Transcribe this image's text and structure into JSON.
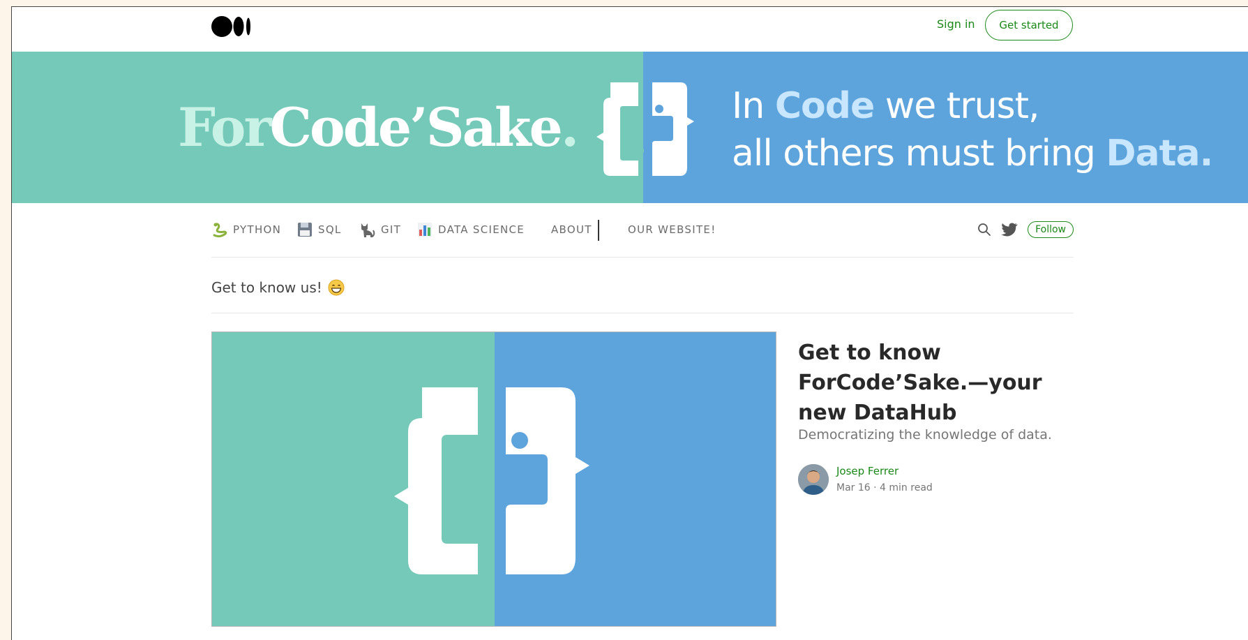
{
  "header": {
    "logo_icon": "medium-logo-icon",
    "signin_label": "Sign in",
    "get_started_label": "Get started",
    "accent_color": "#1a8917"
  },
  "banner": {
    "brand_for": "For",
    "brand_code": "Code",
    "brand_apostrophe": "’",
    "brand_sake": "Sake",
    "brand_dot": ".",
    "logo_icon": "forcodesake-logo-icon",
    "tagline_line1_pre": "In ",
    "tagline_line1_highlight": "Code",
    "tagline_line1_post": " we trust,",
    "tagline_line2_pre": "all others must bring ",
    "tagline_line2_highlight": "Data.",
    "green_color": "#74c9b8",
    "blue_color": "#5da3dc"
  },
  "nav": {
    "items": [
      {
        "label": "PYTHON",
        "icon": "snake-icon"
      },
      {
        "label": "SQL",
        "icon": "floppy-disk-icon"
      },
      {
        "label": "GIT",
        "icon": "cat-icon"
      },
      {
        "label": "DATA SCIENCE",
        "icon": "bar-chart-icon"
      },
      {
        "label": "ABOUT",
        "icon": ""
      }
    ],
    "website_label": "OUR WEBSITE!",
    "search_icon": "search-icon",
    "twitter_icon": "twitter-icon",
    "follow_label": "Follow"
  },
  "section": {
    "title": "Get to know us!",
    "emoji_icon": "grinning-face-icon"
  },
  "post": {
    "title": "Get to know ForCode’Sake.—your new DataHub",
    "subtitle": "Democratizing the knowledge of data.",
    "author": "Josep Ferrer",
    "date": "Mar 16",
    "separator": "·",
    "read_time": "4 min read"
  }
}
